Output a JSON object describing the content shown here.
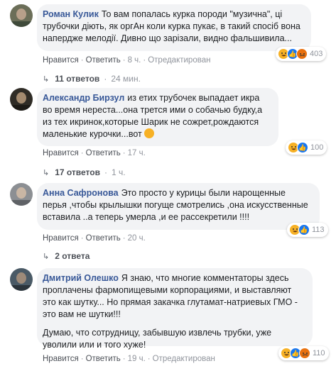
{
  "comments": [
    {
      "author": "Роман Кулик",
      "text": "То вам попалась курка породи \"музична\", ці трубочки діють, як оргАн коли курка пукає, в такий спосіб вона напердже мелодії. Дивно що зарізали, видно фальшивила...",
      "like": "Нравится",
      "reply": "Ответить",
      "time": "8 ч.",
      "edited": "Отредактирован",
      "reaction_icons": [
        "haha-icon",
        "like-icon",
        "angry-icon"
      ],
      "reaction_count": "403",
      "replies": {
        "label": "11 ответов",
        "time": "24 мин."
      }
    },
    {
      "author": "Александр Бирзул",
      "text": "из етих трубочек выпадает икра во время нереста...она трется ими о собачью будку,а из тех икринок,которые Шарик не сожрет,рождаются маленькие курочки...вот",
      "like": "Нравится",
      "reply": "Ответить",
      "time": "17 ч.",
      "reaction_icons": [
        "haha-icon",
        "like-icon"
      ],
      "reaction_count": "100",
      "replies": {
        "label": "17 ответов",
        "time": "1 ч."
      }
    },
    {
      "author": "Анна Сафронова",
      "text": "Это просто у курицы были нарощенные перья ,чтобы крылышки погуще смотрелись ,она искусственные вставила ..а теперь умерла ,и ее рассекретили !!!!",
      "like": "Нравится",
      "reply": "Ответить",
      "time": "20 ч.",
      "reaction_icons": [
        "haha-icon",
        "like-icon"
      ],
      "reaction_count": "113",
      "replies": {
        "label": "2 ответа",
        "time": ""
      }
    },
    {
      "author": "Дмитрий Олешко",
      "text": "Я знаю, что многие комментаторы здесь проплачены фармопищевыми корпорациями, и выставляют это как шутку... Но прямая закачка глутамат-натриевых ГМО - это вам не шутки!!!",
      "text2": "Думаю, что сотрудницу, забывшую извлечь трубки, уже уволили или и того хуже!",
      "like": "Нравится",
      "reply": "Ответить",
      "time": "19 ч.",
      "edited": "Отредактирован",
      "reaction_icons": [
        "haha-icon",
        "like-icon",
        "angry-icon"
      ],
      "reaction_count": "110"
    }
  ],
  "sep": "·"
}
